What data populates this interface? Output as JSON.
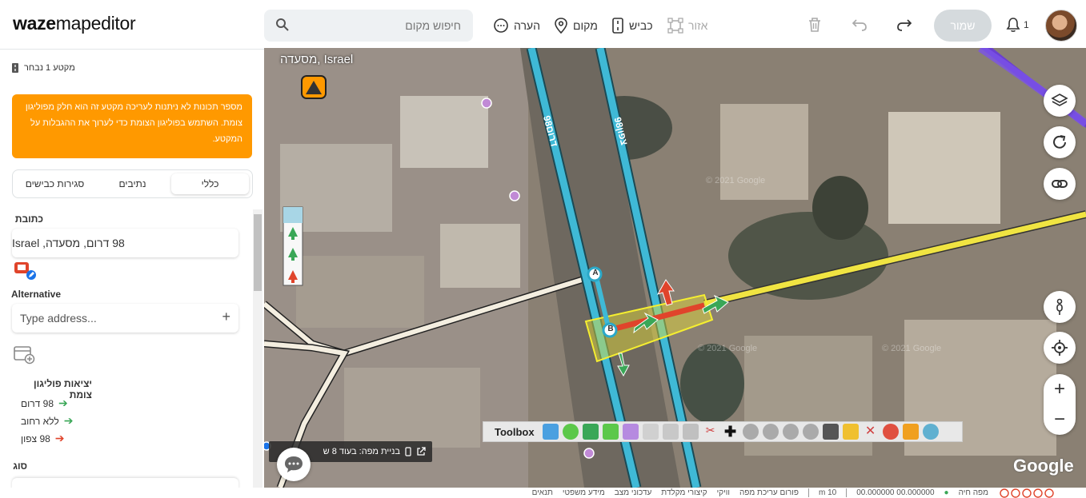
{
  "app": {
    "logo_bold": "waze",
    "logo_rest": "mapeditor"
  },
  "search": {
    "placeholder": "חיפוש מקום"
  },
  "toolbar": {
    "comment_label": "הערה",
    "place_label": "מקום",
    "road_label": "כביש",
    "area_label": "אזור",
    "save_label": "שמור",
    "notification_count": "1"
  },
  "sidebar": {
    "selection_title": "מקטע 1 נבחר",
    "warning_text": "מספר תכונות לא ניתנות לעריכה מקטע זה הוא חלק מפוליגון צומת. השתמש בפוליגון הצומת כדי לערוך את ההגבלות על המקטע.",
    "tabs": [
      "כללי",
      "סגירות כבישים",
      "נתיבים"
    ],
    "address_label": "כתובת",
    "address_value": "98 דרום, מסעדה, Israel",
    "alternative_label": "Alternative",
    "alternative_placeholder": "Type address...",
    "exits_label": "יציאות פוליגון צומת",
    "exits": [
      {
        "label": "98 דרום",
        "color": "#3aa757"
      },
      {
        "label": "ללא רחוב",
        "color": "#3aa757"
      },
      {
        "label": "98 צפון",
        "color": "#e0442b"
      }
    ],
    "type_label": "סוג"
  },
  "map": {
    "location": "מסעדה, Israel",
    "road_label_1": "98דרום",
    "road_label_2": "98צפון",
    "node_a": "A",
    "node_b": "B",
    "toolbox_title": "Toolbox",
    "build_status": "בניית מפה: בעוד 8 ש",
    "google": "Google",
    "watermark": "© 2021 Google"
  },
  "statusbar": {
    "items": [
      "תנאים",
      "מידע משפטי",
      "עדכוני מצב",
      "קיצורי מקלדת",
      "וויקי",
      "פורום עריכת מפה"
    ],
    "scale": "10 m",
    "coords": "00.000000 00.000000",
    "live_map": "מפה חיה"
  },
  "colors": {
    "accent_orange": "#ff9900",
    "road_cyan": "#3fb9d6",
    "road_yellow": "#f0e442",
    "polygon": "#e8e036"
  }
}
